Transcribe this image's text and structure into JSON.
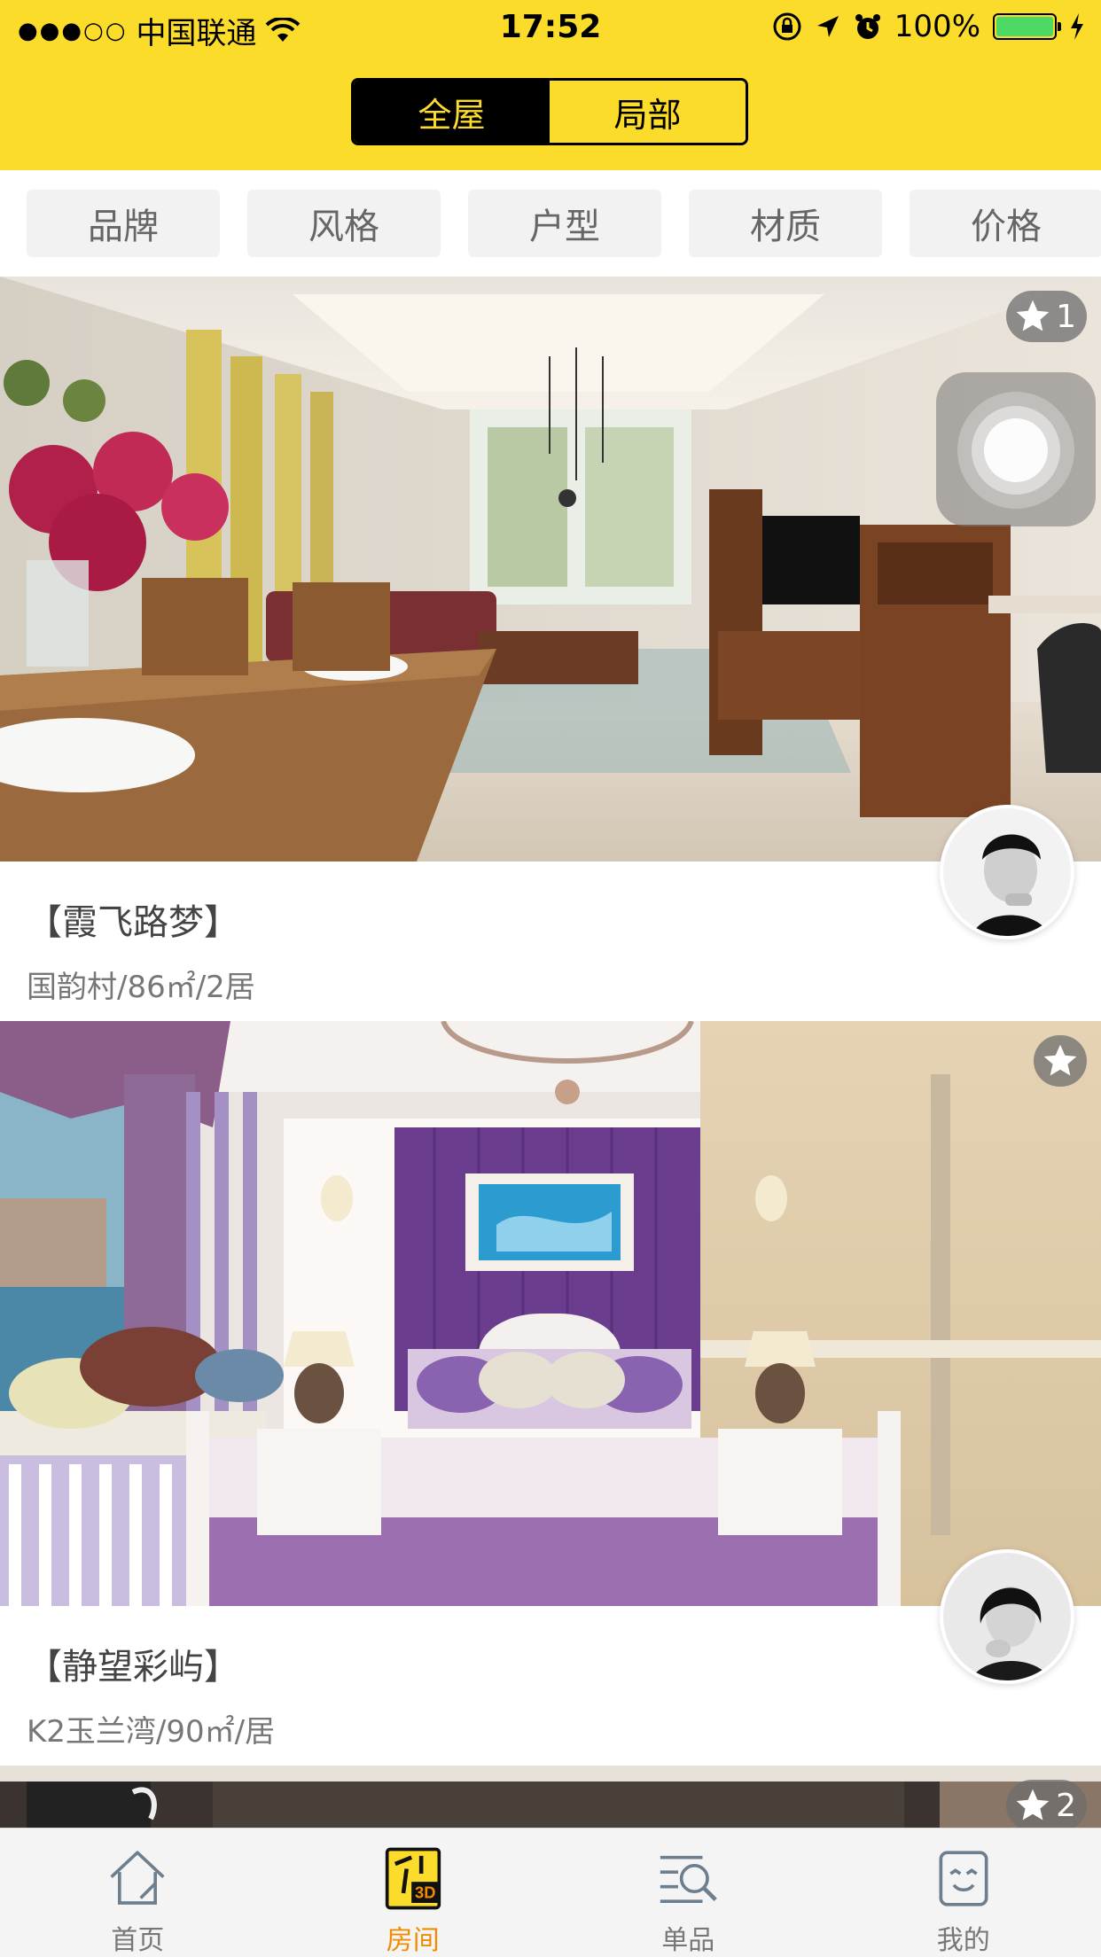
{
  "status_bar": {
    "signal": "●●●○○",
    "carrier": "中国联通",
    "time": "17:52",
    "battery": "100%"
  },
  "segmented": {
    "options": [
      "全屋",
      "局部"
    ],
    "selected": "全屋"
  },
  "filters": [
    "品牌",
    "风格",
    "户型",
    "材质",
    "价格"
  ],
  "cards": [
    {
      "title": "【霞飞路梦】",
      "meta": "国韵村/86㎡/2居",
      "favorites": "1"
    },
    {
      "title": "【静望彩屿】",
      "meta": "K2玉兰湾/90㎡/居",
      "favorites": ""
    },
    {
      "favorites": "2"
    }
  ],
  "tabs": [
    {
      "label": "首页",
      "icon": "house-icon"
    },
    {
      "label": "房间",
      "icon": "room-3d-icon"
    },
    {
      "label": "单品",
      "icon": "search-list-icon"
    },
    {
      "label": "我的",
      "icon": "profile-icon"
    }
  ],
  "colors": {
    "brand_yellow": "#fcdc2b",
    "active_tab": "#f08c00",
    "battery_green": "#4cd964"
  }
}
